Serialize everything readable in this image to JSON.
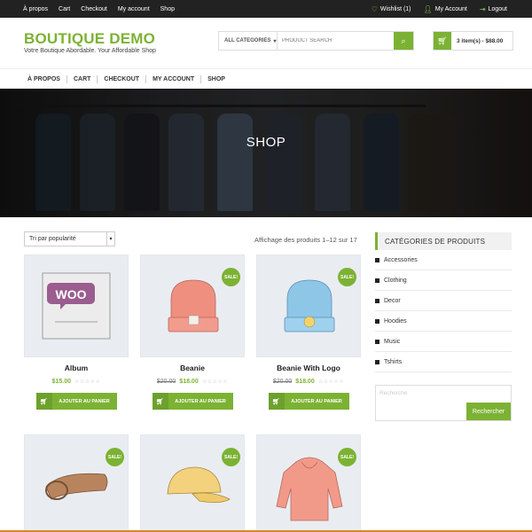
{
  "topbar": {
    "left_links": [
      "À propos",
      "Cart",
      "Checkout",
      "My account",
      "Shop"
    ],
    "wishlist": "Wishlist (1)",
    "my_account": "My Account",
    "logout": "Logout"
  },
  "brand": {
    "title": "BOUTIQUE DEMO",
    "tagline": "Votre Boutique Abordable. Your Affordable Shop"
  },
  "search": {
    "category": "ALL CATEGORIES",
    "placeholder": "PRODUCT SEARCH"
  },
  "cart": {
    "summary": "3 item(s) - $88.00"
  },
  "nav": {
    "items": [
      "À PROPOS",
      "CART",
      "CHECKOUT",
      "MY ACCOUNT",
      "SHOP"
    ]
  },
  "hero": {
    "title": "SHOP"
  },
  "shop": {
    "sort_value": "Tri par popularité",
    "result_count": "Affichage des produits 1–12 sur 17",
    "add_to_cart_label": "AJOUTER AU PANIER",
    "sale_label": "SALE!",
    "products": [
      {
        "name": "Album",
        "old_price": "",
        "price": "$15.00",
        "sale": false
      },
      {
        "name": "Beanie",
        "old_price": "$20.00",
        "price": "$18.00",
        "sale": true
      },
      {
        "name": "Beanie With Logo",
        "old_price": "$20.00",
        "price": "$18.00",
        "sale": true
      },
      {
        "name": "Belt",
        "old_price": "",
        "price": "",
        "sale": true
      },
      {
        "name": "Cap",
        "old_price": "",
        "price": "",
        "sale": true
      },
      {
        "name": "Hoodie",
        "old_price": "",
        "price": "",
        "sale": true
      }
    ]
  },
  "sidebar": {
    "title": "CATÉGORIES DE PRODUITS",
    "categories": [
      "Accessories",
      "Clothing",
      "Decor",
      "Hoodies",
      "Music",
      "Tshirts"
    ],
    "search_placeholder": "Recherche",
    "search_button": "Rechercher"
  },
  "colors": {
    "accent": "#7cb233",
    "topbar": "#222222"
  }
}
